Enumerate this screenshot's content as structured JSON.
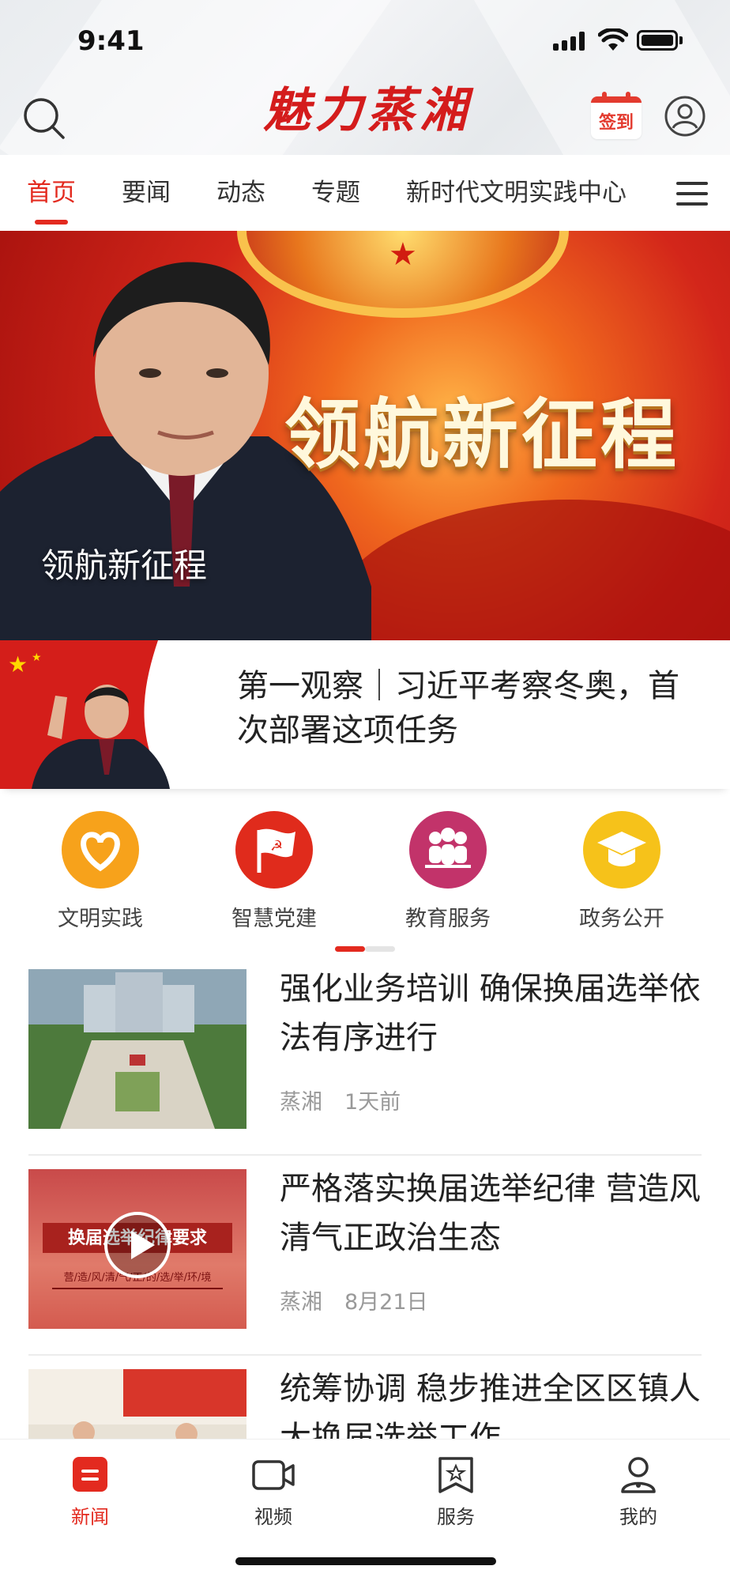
{
  "status_bar": {
    "time": "9:41"
  },
  "header": {
    "brand": "魅力蒸湘",
    "signin_label": "签到"
  },
  "tabs": [
    {
      "label": "首页",
      "active": true
    },
    {
      "label": "要闻",
      "active": false
    },
    {
      "label": "动态",
      "active": false
    },
    {
      "label": "专题",
      "active": false
    },
    {
      "label": "新时代文明实践中心",
      "active": false
    }
  ],
  "banner": {
    "headline": "领航新征程",
    "caption": "领航新征程"
  },
  "featured": {
    "title": "第一观察｜习近平考察冬奥，首次部署这项任务"
  },
  "entries": [
    {
      "label": "文明实践",
      "icon": "heart-icon",
      "color": "#f7a21b"
    },
    {
      "label": "智慧党建",
      "icon": "party-flag-icon",
      "color": "#e02b1c"
    },
    {
      "label": "教育服务",
      "icon": "people-icon",
      "color": "#c2336a"
    },
    {
      "label": "政务公开",
      "icon": "graduation-cap-icon",
      "color": "#f6c21a"
    }
  ],
  "news": [
    {
      "title": "强化业务培训 确保换届选举依法有序进行",
      "source": "蒸湘",
      "time": "1天前",
      "has_video": false
    },
    {
      "title": "严格落实换届选举纪律 营造风清气正政治生态",
      "source": "蒸湘",
      "time": "8月21日",
      "has_video": true,
      "thumb_text": "换届选举纪律要求",
      "thumb_subtext": "营/造/风/清/气/正/的/选/举/环/境"
    },
    {
      "title": "统筹协调 稳步推进全区区镇人大换届选举工作",
      "source": "",
      "time": "",
      "has_video": false
    }
  ],
  "bottom_nav": [
    {
      "label": "新闻",
      "icon": "news-icon",
      "active": true
    },
    {
      "label": "视频",
      "icon": "video-icon",
      "active": false
    },
    {
      "label": "服务",
      "icon": "service-icon",
      "active": false
    },
    {
      "label": "我的",
      "icon": "user-icon",
      "active": false
    }
  ],
  "colors": {
    "accent": "#e32a1f",
    "text": "#222222",
    "muted": "#999999"
  }
}
